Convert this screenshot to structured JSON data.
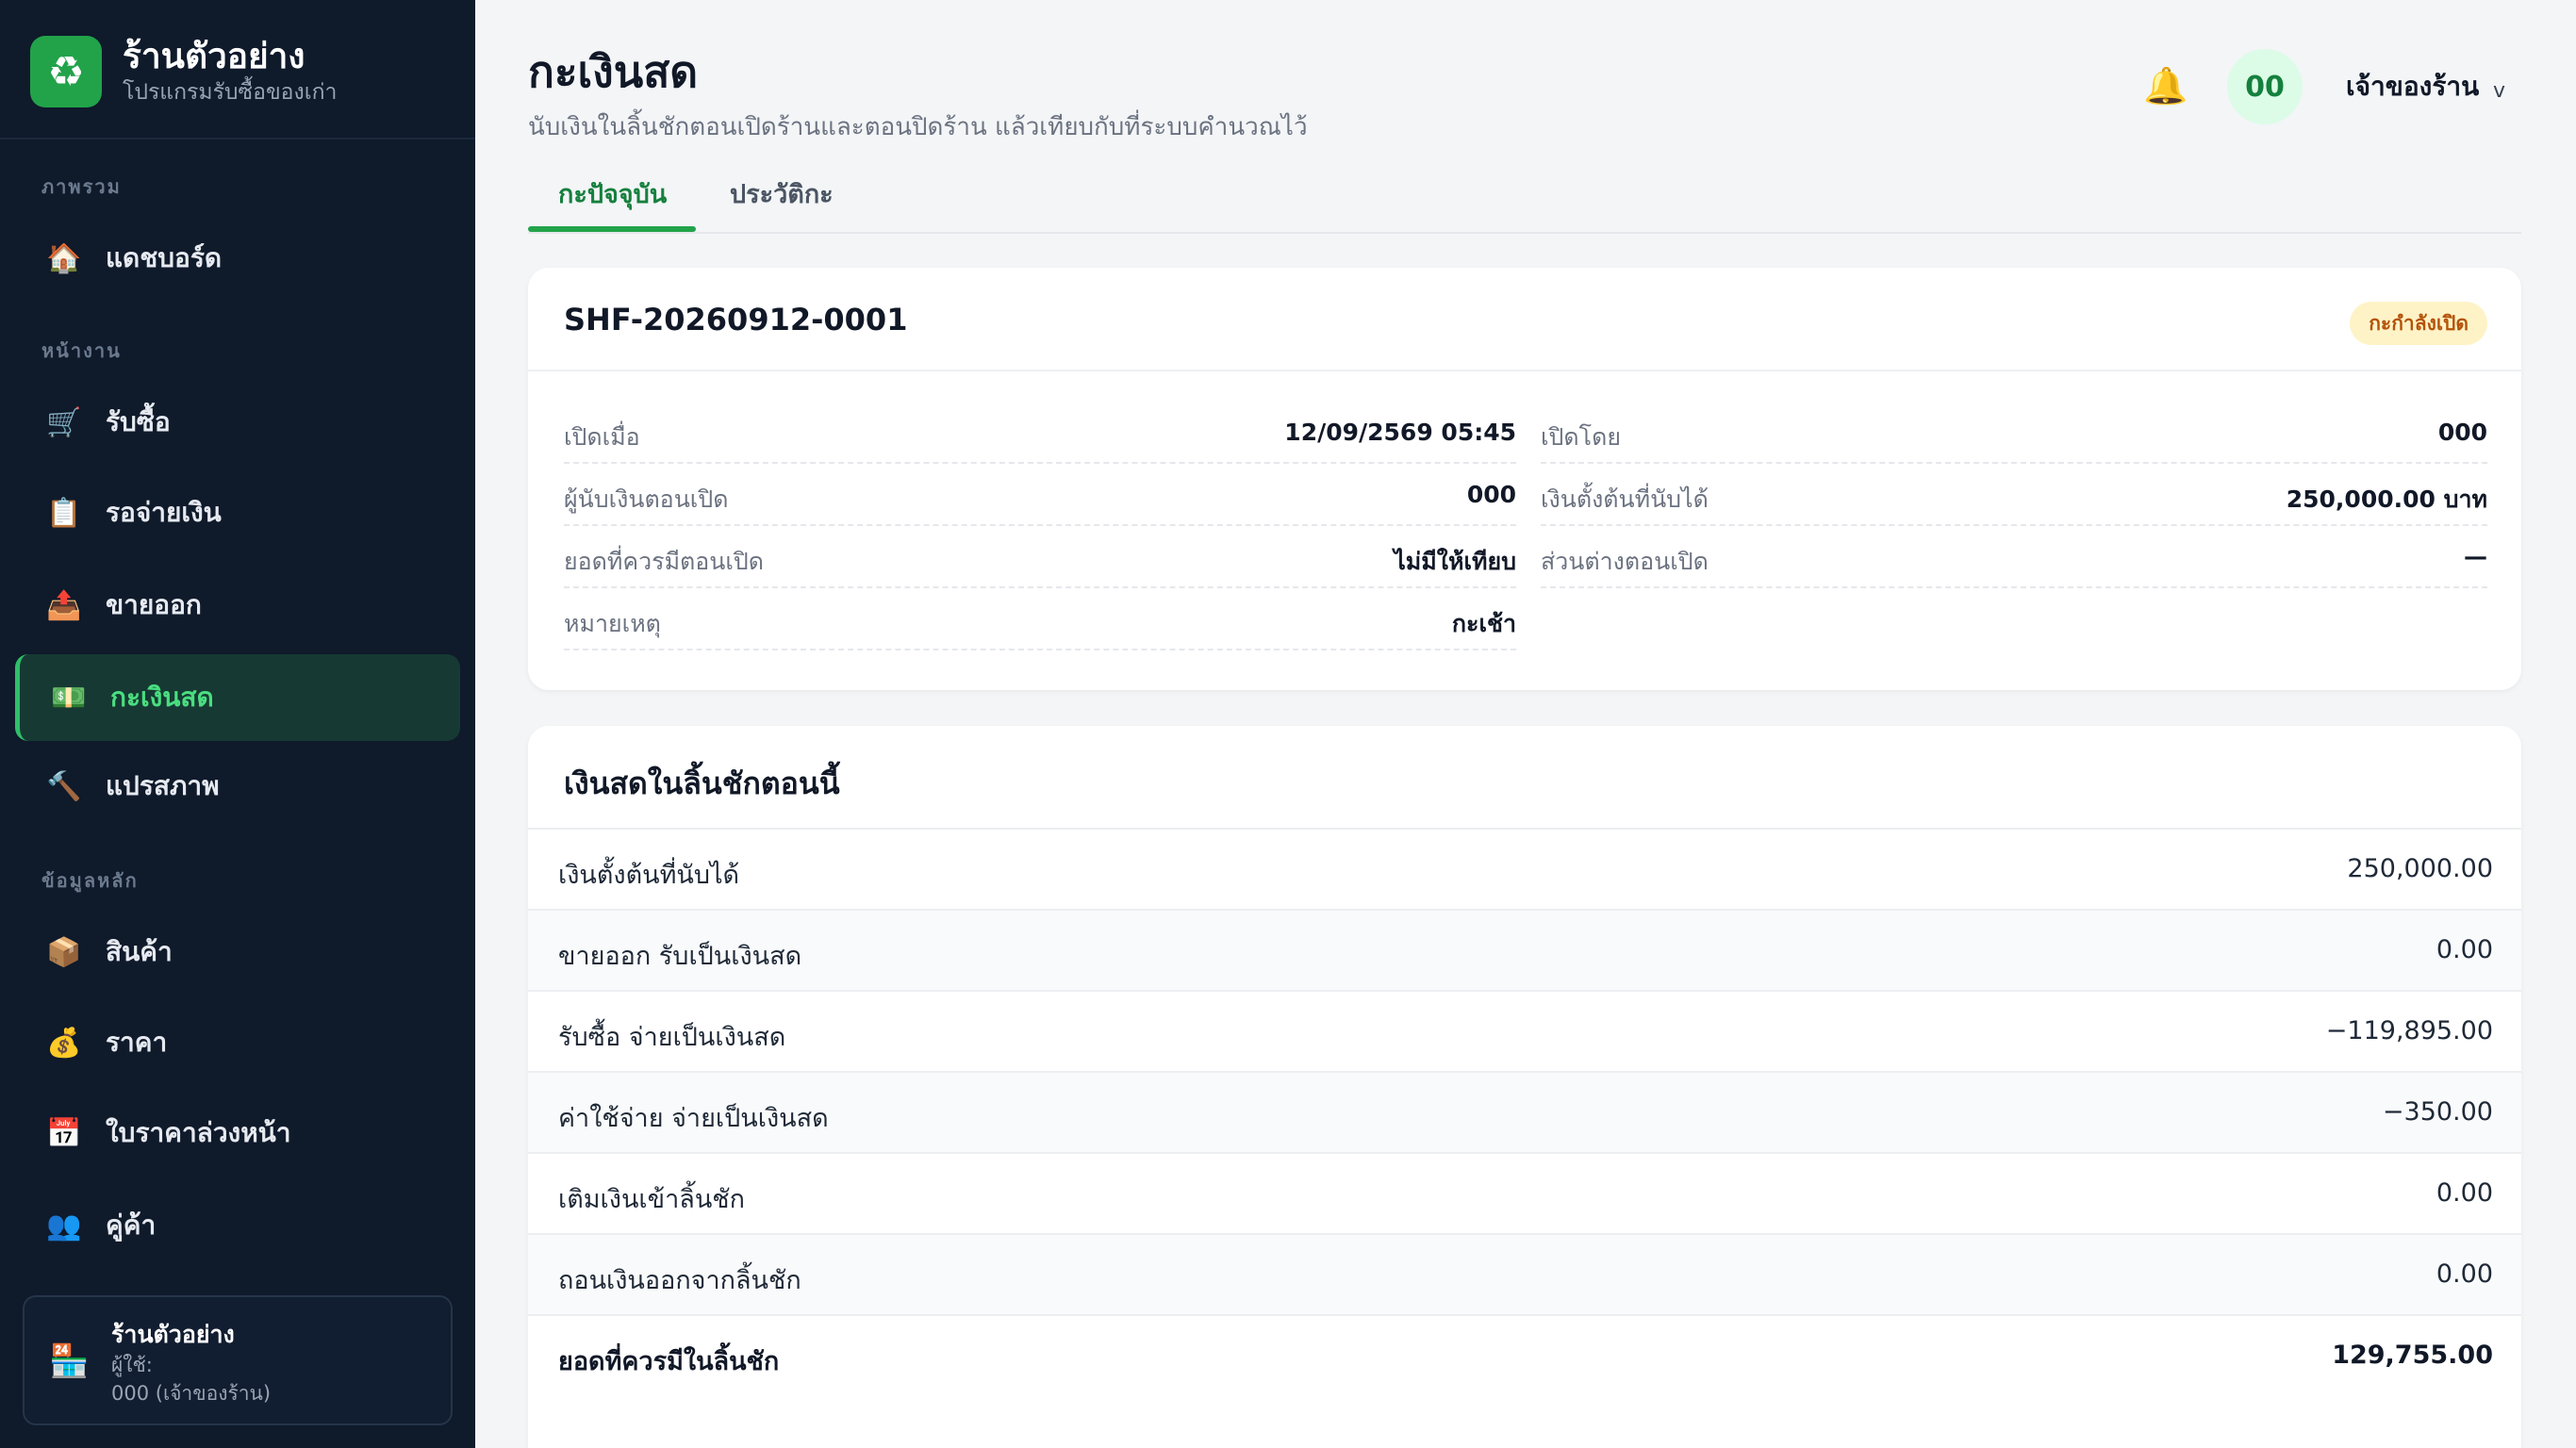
{
  "brand": {
    "name": "ร้านตัวอย่าง",
    "subtitle": "โปรแกรมรับซื้อของเก่า",
    "icon": "recycle-icon"
  },
  "sidebar": {
    "sections": {
      "overview": "ภาพรวม",
      "work": "หน้างาน",
      "master": "ข้อมูลหลัก"
    },
    "items": [
      {
        "label": "แดชบอร์ด",
        "icon": "house-icon",
        "glyph": "🏠"
      },
      {
        "label": "รับซื้อ",
        "icon": "cart-icon",
        "glyph": "🛒"
      },
      {
        "label": "รอจ่ายเงิน",
        "icon": "clipboard-icon",
        "glyph": "📋"
      },
      {
        "label": "ขายออก",
        "icon": "outbox-icon",
        "glyph": "📤"
      },
      {
        "label": "กะเงินสด",
        "icon": "cash-icon",
        "glyph": "💵",
        "active": true
      },
      {
        "label": "แปรสภาพ",
        "icon": "hammer-icon",
        "glyph": "🔨"
      },
      {
        "label": "สินค้า",
        "icon": "package-icon",
        "glyph": "📦"
      },
      {
        "label": "ราคา",
        "icon": "money-bag-icon",
        "glyph": "💰"
      },
      {
        "label": "ใบราคาล่วงหน้า",
        "icon": "calendar-icon",
        "glyph": "📅"
      },
      {
        "label": "คู่ค้า",
        "icon": "people-icon",
        "glyph": "👥"
      }
    ],
    "store": {
      "name": "ร้านตัวอย่าง",
      "user_label": "ผู้ใช้:",
      "user_value": "000 (เจ้าของร้าน)",
      "icon": "store-icon",
      "glyph": "🏪"
    }
  },
  "header": {
    "title": "กะเงินสด",
    "subtitle": "นับเงินในลิ้นชักตอนเปิดร้านและตอนปิดร้าน แล้วเทียบกับที่ระบบคำนวณไว้",
    "bell_glyph": "🔔",
    "avatar": "00",
    "user_name": "เจ้าของร้าน",
    "chevron": "v"
  },
  "tabs": {
    "current": "กะปัจจุบัน",
    "history": "ประวัติกะ"
  },
  "shift": {
    "id": "SHF-20260912-0001",
    "status": "กะกำลังเปิด",
    "left": [
      {
        "label": "เปิดเมื่อ",
        "value": "12/09/2569 05:45"
      },
      {
        "label": "ผู้นับเงินตอนเปิด",
        "value": "000"
      },
      {
        "label": "ยอดที่ควรมีตอนเปิด",
        "value": "ไม่มีให้เทียบ"
      },
      {
        "label": "หมายเหตุ",
        "value": "กะเช้า"
      }
    ],
    "right": [
      {
        "label": "เปิดโดย",
        "value": "000"
      },
      {
        "label": "เงินตั้งต้นที่นับได้",
        "value": "250,000.00 บาท"
      },
      {
        "label": "ส่วนต่างตอนเปิด",
        "value": "—"
      }
    ]
  },
  "cash": {
    "title": "เงินสดในลิ้นชักตอนนี้",
    "rows": [
      {
        "label": "เงินตั้งต้นที่นับได้",
        "value": "250,000.00"
      },
      {
        "label": "ขายออก รับเป็นเงินสด",
        "value": "0.00"
      },
      {
        "label": "รับซื้อ จ่ายเป็นเงินสด",
        "value": "−119,895.00"
      },
      {
        "label": "ค่าใช้จ่าย จ่ายเป็นเงินสด",
        "value": "−350.00"
      },
      {
        "label": "เติมเงินเข้าลิ้นชัก",
        "value": "0.00"
      },
      {
        "label": "ถอนเงินออกจากลิ้นชัก",
        "value": "0.00"
      }
    ],
    "total": {
      "label": "ยอดที่ควรมีในลิ้นชัก",
      "value": "129,755.00"
    }
  },
  "colors": {
    "sidebar_bg": "#0f1a2b",
    "accent": "#22a34a",
    "active_text": "#4ade80",
    "badge_bg": "#fef3c7",
    "badge_text": "#b45309"
  }
}
